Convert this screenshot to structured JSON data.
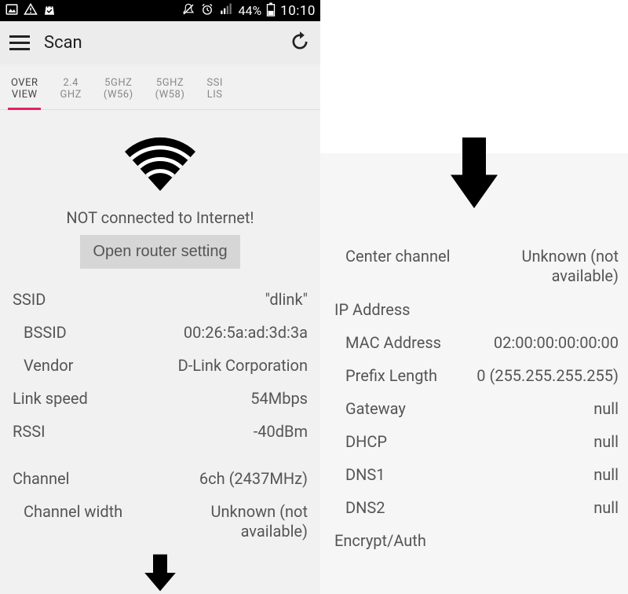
{
  "status": {
    "battery": "44%",
    "time": "10:10"
  },
  "appbar": {
    "title": "Scan"
  },
  "tabs": [
    {
      "line1": "OVER",
      "line2": "VIEW",
      "active": true
    },
    {
      "line1": "2.4",
      "line2": "GHZ"
    },
    {
      "line1": "5GHZ",
      "line2": "(W56)"
    },
    {
      "line1": "5GHZ",
      "line2": "(W58)"
    },
    {
      "line1": "SSI",
      "line2": "LIS"
    }
  ],
  "hero": {
    "warn": "NOT connected to Internet!",
    "router_btn": "Open router setting"
  },
  "left_rows": [
    {
      "label": "SSID",
      "value": "\"dlink\""
    },
    {
      "label": "BSSID",
      "value": "00:26:5a:ad:3d:3a",
      "indent": true
    },
    {
      "label": "Vendor",
      "value": "D-Link Corporation",
      "indent": true
    },
    {
      "label": "Link speed",
      "value": "54Mbps"
    },
    {
      "label": "RSSI",
      "value": "-40dBm"
    },
    {
      "label": "",
      "value": ""
    },
    {
      "label": "Channel",
      "value": "6ch (2437MHz)"
    },
    {
      "label": "Channel width",
      "value": "Unknown (not available)",
      "indent": true,
      "tworow": true
    }
  ],
  "right_rows": [
    {
      "label": "Center channel",
      "value": "Unknown (not available)",
      "indent": true,
      "tworow": true
    },
    {
      "label": "IP Address",
      "value": ""
    },
    {
      "label": "MAC Address",
      "value": "02:00:00:00:00:00",
      "indent": true
    },
    {
      "label": "Prefix Length",
      "value": "0 (255.255.255.255)",
      "indent": true
    },
    {
      "label": "Gateway",
      "value": "null",
      "indent": true
    },
    {
      "label": "DHCP",
      "value": "null",
      "indent": true
    },
    {
      "label": "DNS1",
      "value": "null",
      "indent": true
    },
    {
      "label": "DNS2",
      "value": "null",
      "indent": true
    },
    {
      "label": "Encrypt/Auth",
      "value": ""
    }
  ]
}
